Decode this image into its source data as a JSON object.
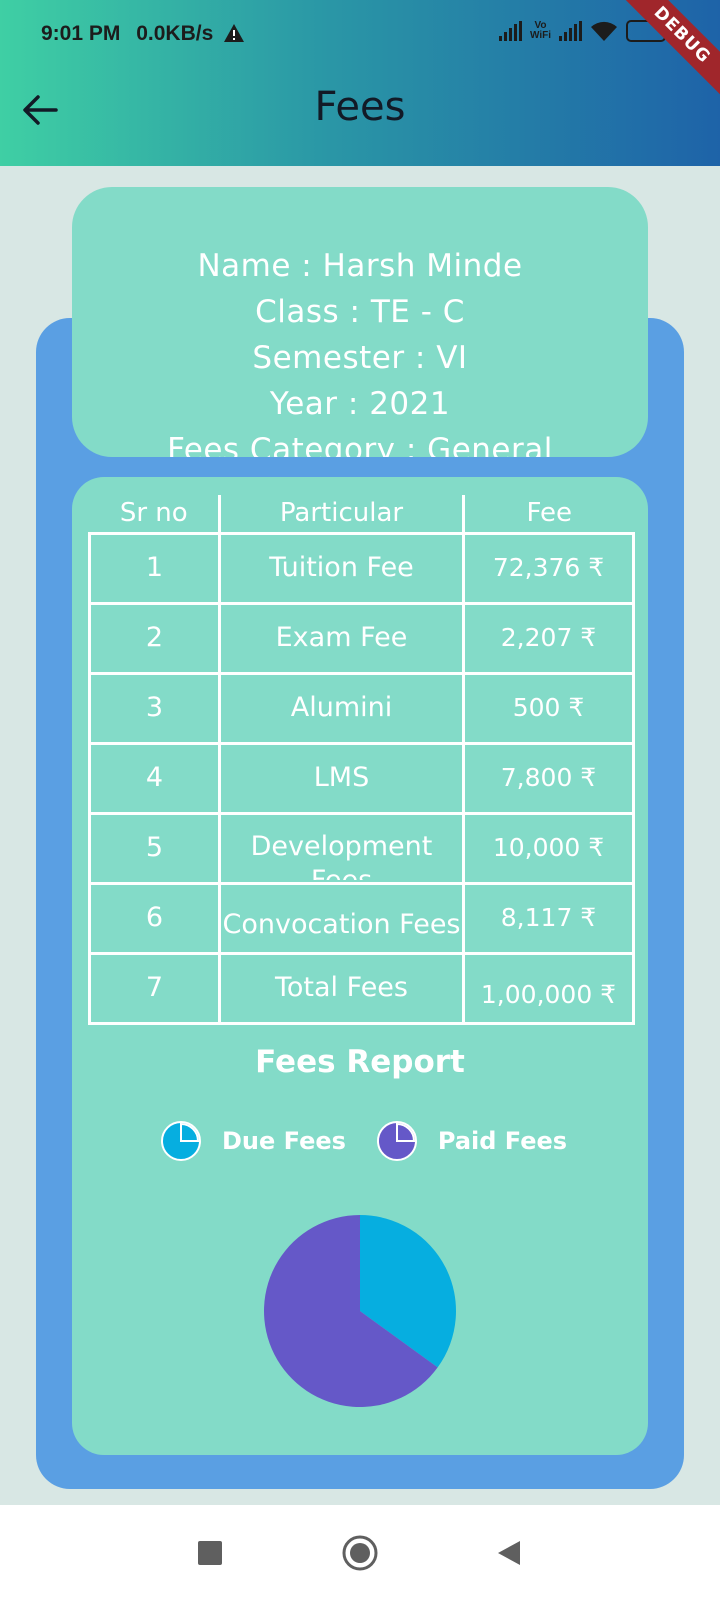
{
  "status_bar": {
    "time": "9:01 PM",
    "speed": "0.0KB/s",
    "vowifi_top": "Vo",
    "vowifi_bottom": "WiFi",
    "debug": "DEBUG"
  },
  "appbar": {
    "title": "Fees",
    "back_icon": "arrow-left-icon"
  },
  "student": {
    "name": "Name : Harsh Minde",
    "class": "Class : TE - C",
    "semester": "Semester : VI",
    "year": "Year : 2021",
    "category": "Fees Category : General"
  },
  "fee_table": {
    "headers": [
      "Sr no",
      "Particular",
      "Fee"
    ],
    "rows": [
      {
        "sr": "1",
        "particular": "Tuition Fee",
        "fee": "72,376  ₹"
      },
      {
        "sr": "2",
        "particular": "Exam Fee",
        "fee": "2,207 ₹"
      },
      {
        "sr": "3",
        "particular": "Alumini",
        "fee": "500 ₹"
      },
      {
        "sr": "4",
        "particular": "LMS",
        "fee": "7,800  ₹"
      },
      {
        "sr": "5",
        "particular": "Development Fees",
        "fee": "10,000  ₹"
      },
      {
        "sr": "6",
        "particular": "Convocation Fees",
        "fee": "8,117  ₹"
      },
      {
        "sr": "7",
        "particular": "Total Fees",
        "fee": "1,00,000 ₹"
      }
    ]
  },
  "report": {
    "title": "Fees Report",
    "legend": [
      {
        "label": "Due Fees",
        "color": "#06aee0"
      },
      {
        "label": "Paid Fees",
        "color": "#6558c8"
      }
    ]
  },
  "chart_data": {
    "type": "pie",
    "title": "Fees Report",
    "slices": [
      {
        "label": "Due Fees",
        "value": 35,
        "color": "#06aee0"
      },
      {
        "label": "Paid Fees",
        "value": 65,
        "color": "#6558c8"
      }
    ],
    "legend_position": "top"
  },
  "navbar": {
    "icons": [
      "recents-square-icon",
      "home-circle-icon",
      "back-triangle-icon"
    ]
  }
}
